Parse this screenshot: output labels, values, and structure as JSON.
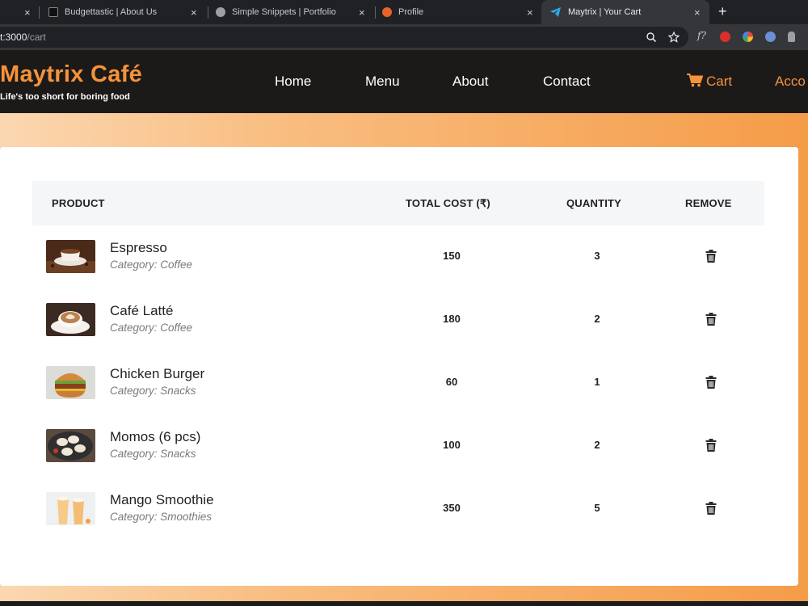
{
  "browser": {
    "tabs": [
      {
        "title": "",
        "active": false
      },
      {
        "title": "Budgettastic | About Us",
        "active": false
      },
      {
        "title": "Simple Snippets | Portfolio",
        "active": false
      },
      {
        "title": "Profile",
        "active": false
      },
      {
        "title": "Maytrix | Your Cart",
        "active": true
      }
    ],
    "close_glyph": "×",
    "new_tab_glyph": "+",
    "url_visible": "t:3000",
    "url_path": "/cart"
  },
  "site": {
    "brand": "Maytrix Café",
    "tagline": "Life's too short for boring food",
    "nav": {
      "home": "Home",
      "menu": "Menu",
      "about": "About",
      "contact": "Contact",
      "cart": "Cart",
      "account": "Acco"
    },
    "accent_color": "#f6923a"
  },
  "cart": {
    "headers": {
      "product": "PRODUCT",
      "total_cost": "TOTAL COST (₹)",
      "quantity": "QUANTITY",
      "remove": "REMOVE"
    },
    "items": [
      {
        "name": "Espresso",
        "category": "Category: Coffee",
        "cost": "150",
        "quantity": "3",
        "thumb_icon": "espresso-image"
      },
      {
        "name": "Café Latté",
        "category": "Category: Coffee",
        "cost": "180",
        "quantity": "2",
        "thumb_icon": "latte-image"
      },
      {
        "name": "Chicken Burger",
        "category": "Category: Snacks",
        "cost": "60",
        "quantity": "1",
        "thumb_icon": "burger-image"
      },
      {
        "name": "Momos (6 pcs)",
        "category": "Category: Snacks",
        "cost": "100",
        "quantity": "2",
        "thumb_icon": "momos-image"
      },
      {
        "name": "Mango Smoothie",
        "category": "Category: Smoothies",
        "cost": "350",
        "quantity": "5",
        "thumb_icon": "smoothie-image"
      }
    ]
  }
}
